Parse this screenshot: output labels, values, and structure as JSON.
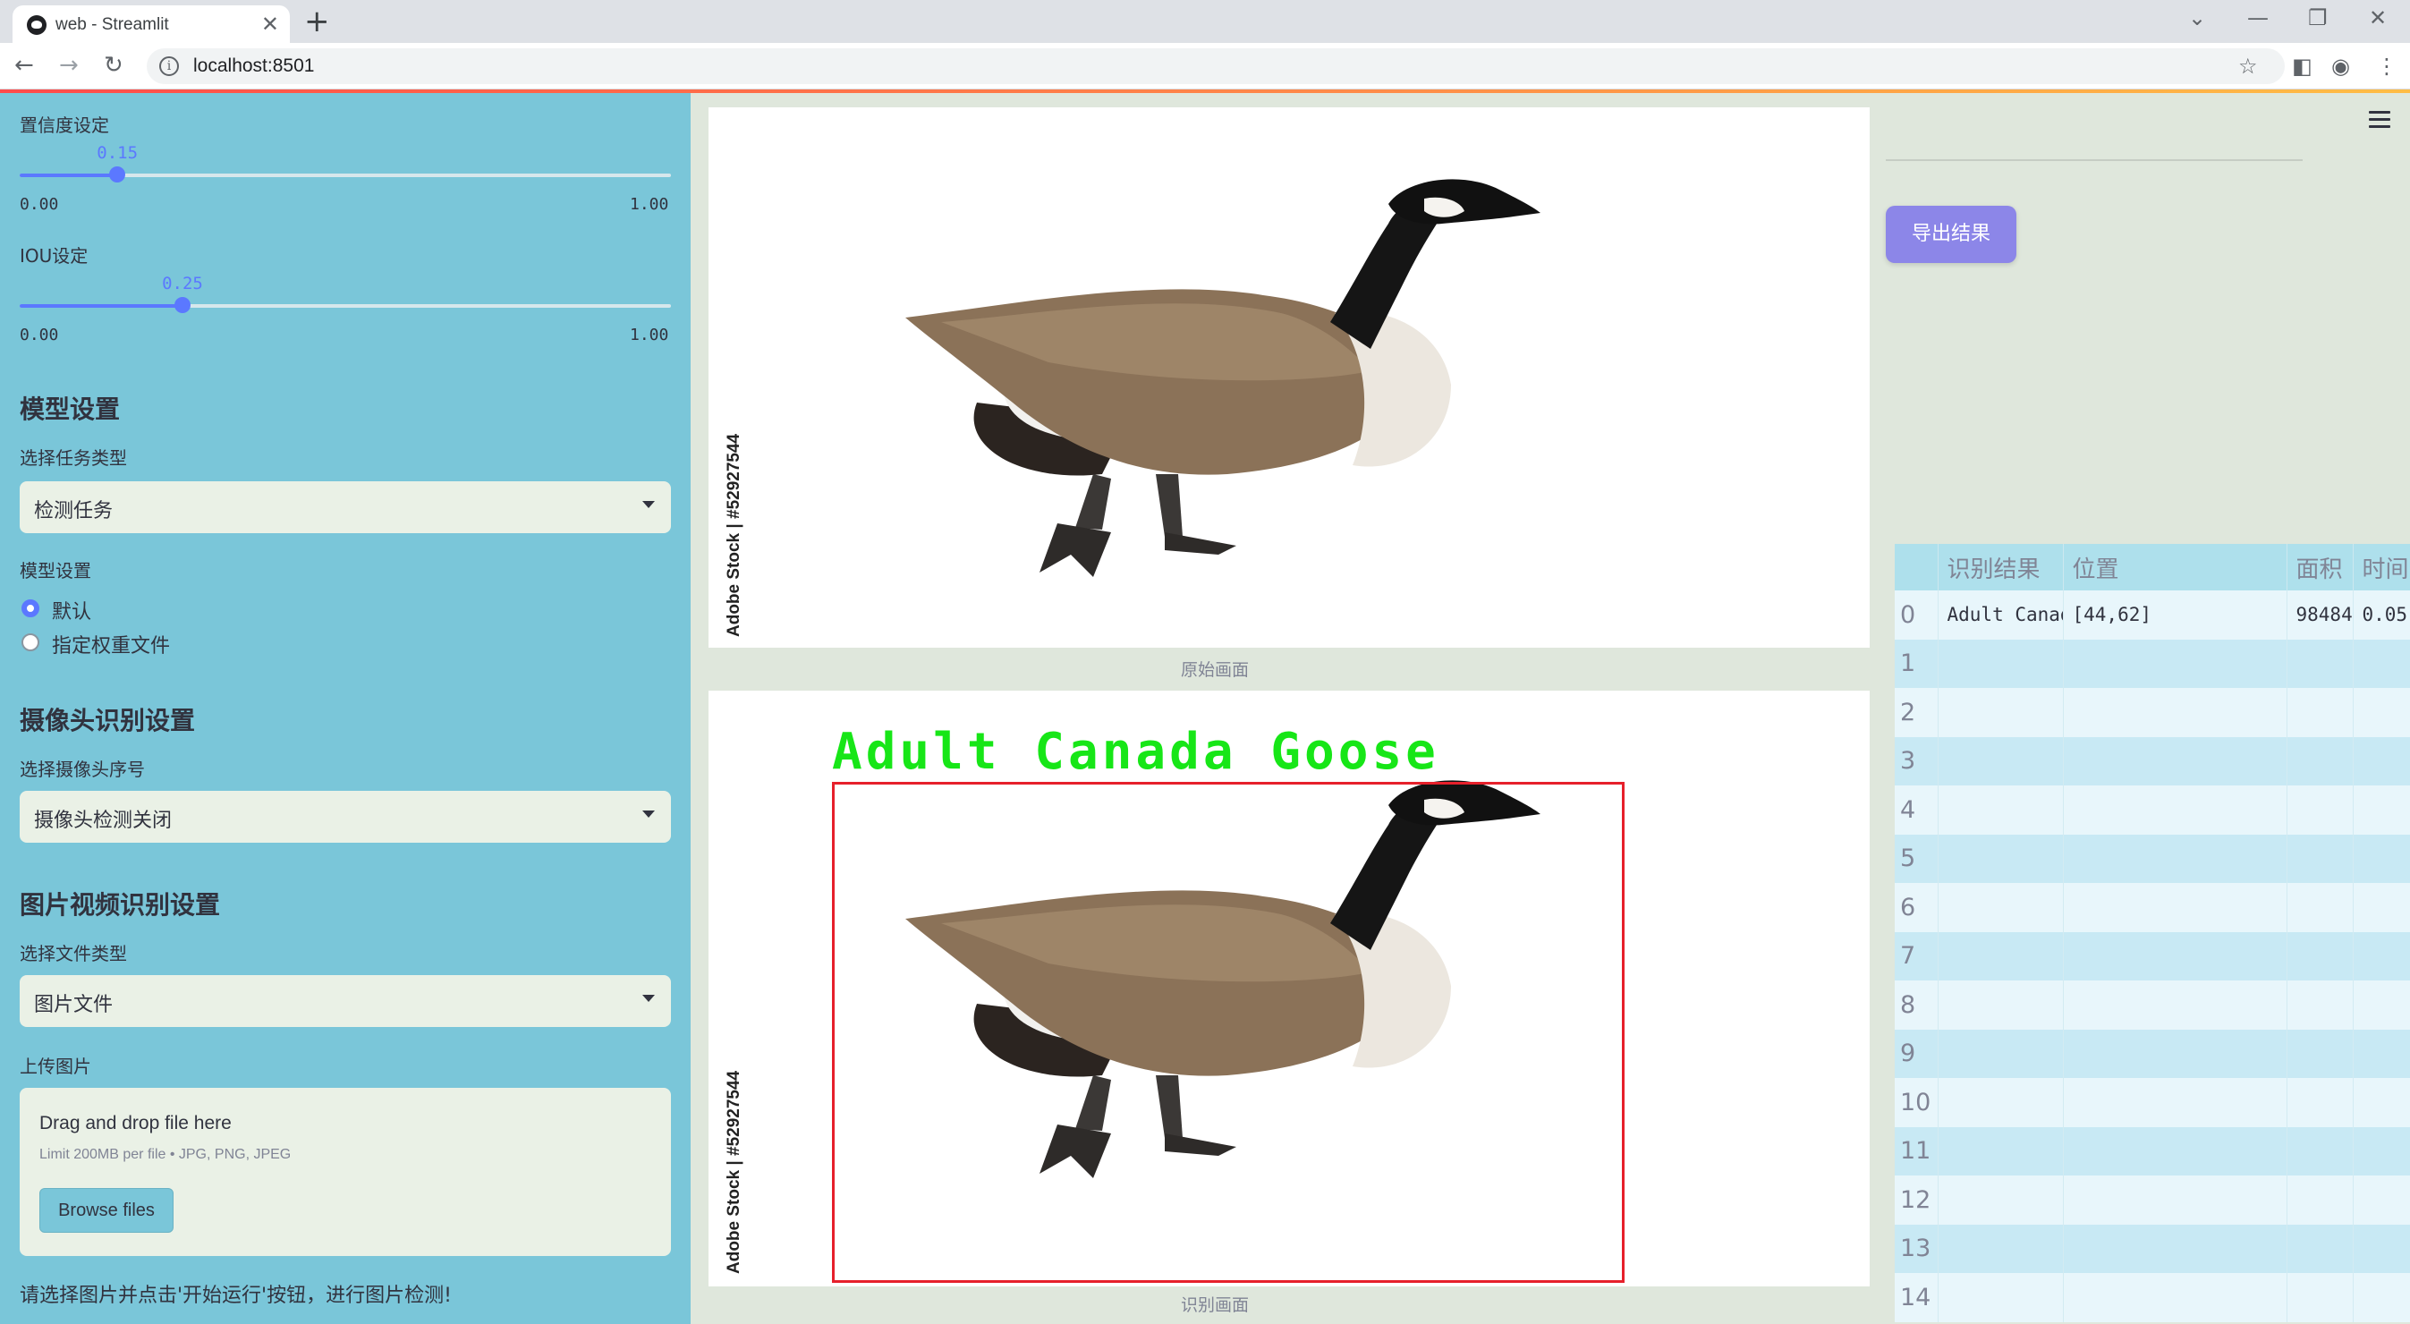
{
  "browser": {
    "tab_title": "web - Streamlit",
    "url": "localhost:8501"
  },
  "sidebar": {
    "confidence_label": "置信度设定",
    "confidence_value": "0.15",
    "confidence_fraction": 0.15,
    "confidence_min": "0.00",
    "confidence_max": "1.00",
    "iou_label": "IOU设定",
    "iou_value": "0.25",
    "iou_fraction": 0.25,
    "iou_min": "0.00",
    "iou_max": "1.00",
    "model_section": "模型设置",
    "task_type_label": "选择任务类型",
    "task_type_value": "检测任务",
    "model_settings_label": "模型设置",
    "radio_default": "默认",
    "radio_custom": "指定权重文件",
    "camera_section": "摄像头识别设置",
    "camera_select_label": "选择摄像头序号",
    "camera_select_value": "摄像头检测关闭",
    "media_section": "图片视频识别设置",
    "file_type_label": "选择文件类型",
    "file_type_value": "图片文件",
    "upload_label": "上传图片",
    "upload_title": "Drag and drop file here",
    "upload_limit": "Limit 200MB per file • JPG, PNG, JPEG",
    "browse_button": "Browse files",
    "hint": "请选择图片并点击'开始运行'按钮，进行图片检测!"
  },
  "main": {
    "image_watermark": "Adobe Stock | #52927544",
    "original_caption": "原始画面",
    "detected_caption": "识别画面",
    "detection_label": "Adult Canada Goose"
  },
  "right": {
    "export_button": "导出结果",
    "table_headers": [
      "",
      "识别结果",
      "位置",
      "面积",
      "时间"
    ],
    "rows": [
      {
        "index": "0",
        "result": "Adult Canada Goose",
        "position": "[44,62]",
        "area": "98484",
        "time": "0.05"
      },
      {
        "index": "1",
        "result": "",
        "position": "",
        "area": "",
        "time": ""
      },
      {
        "index": "2",
        "result": "",
        "position": "",
        "area": "",
        "time": ""
      },
      {
        "index": "3",
        "result": "",
        "position": "",
        "area": "",
        "time": ""
      },
      {
        "index": "4",
        "result": "",
        "position": "",
        "area": "",
        "time": ""
      },
      {
        "index": "5",
        "result": "",
        "position": "",
        "area": "",
        "time": ""
      },
      {
        "index": "6",
        "result": "",
        "position": "",
        "area": "",
        "time": ""
      },
      {
        "index": "7",
        "result": "",
        "position": "",
        "area": "",
        "time": ""
      },
      {
        "index": "8",
        "result": "",
        "position": "",
        "area": "",
        "time": ""
      },
      {
        "index": "9",
        "result": "",
        "position": "",
        "area": "",
        "time": ""
      },
      {
        "index": "10",
        "result": "",
        "position": "",
        "area": "",
        "time": ""
      },
      {
        "index": "11",
        "result": "",
        "position": "",
        "area": "",
        "time": ""
      },
      {
        "index": "12",
        "result": "",
        "position": "",
        "area": "",
        "time": ""
      },
      {
        "index": "13",
        "result": "",
        "position": "",
        "area": "",
        "time": ""
      },
      {
        "index": "14",
        "result": "",
        "position": "",
        "area": "",
        "time": ""
      }
    ]
  },
  "colors": {
    "sidebar_bg": "#7ac6d9",
    "accent": "#5b78ff",
    "export_button": "#8c86e8",
    "detection_box": "#e6202b",
    "detection_text": "#17e617"
  }
}
